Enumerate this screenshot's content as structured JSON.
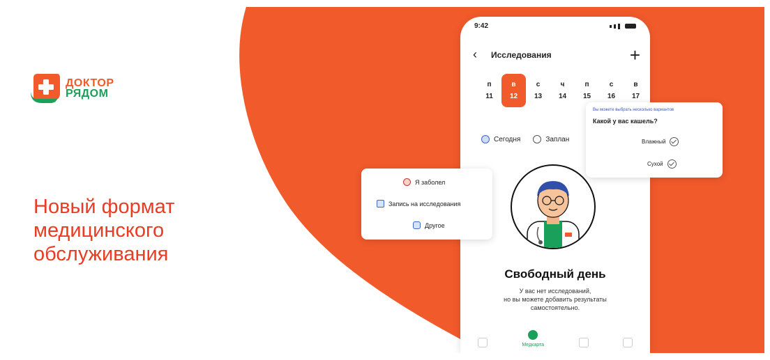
{
  "brand": {
    "line1": "ДОКТОР",
    "line2": "РЯДОМ",
    "accent": "#f15a2b",
    "green": "#1aa05a"
  },
  "headline": [
    "Новый формат",
    "медицинского",
    "обслуживания"
  ],
  "phone": {
    "status_time": "9:42",
    "nav_title": "Исследования",
    "back_icon": "chevron-left-icon",
    "add_icon": "plus-icon",
    "days": [
      {
        "label": "п",
        "num": "11"
      },
      {
        "label": "в",
        "num": "12",
        "active": true
      },
      {
        "label": "с",
        "num": "13"
      },
      {
        "label": "ч",
        "num": "14"
      },
      {
        "label": "п",
        "num": "15"
      },
      {
        "label": "с",
        "num": "16"
      },
      {
        "label": "в",
        "num": "17"
      }
    ],
    "pills": [
      "Сегодня",
      "Заплан"
    ],
    "free_title": "Свободный день",
    "free_sub": [
      "У вас нет исследований,",
      "но вы можете добавить результаты",
      "самостоятельно."
    ],
    "tabs": [
      "",
      "Медкарта",
      "",
      ""
    ]
  },
  "card_left": {
    "items": [
      "Я заболел",
      "Запись на исследования",
      "Другое"
    ]
  },
  "card_right": {
    "hint": "Вы можете выбрать несколько вариантов",
    "question": "Какой у вас кашель?",
    "options": [
      "Влажный",
      "Сухой"
    ]
  }
}
